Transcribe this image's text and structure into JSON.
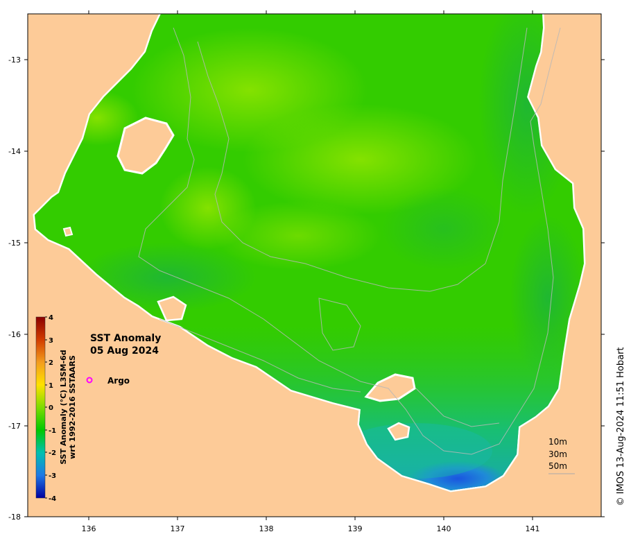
{
  "map": {
    "title_line1": "SST Anomaly",
    "title_line2": "05 Aug 2024",
    "x_ticks": [
      "136",
      "137",
      "138",
      "139",
      "140",
      "141"
    ],
    "y_ticks": [
      "-13",
      "-14",
      "-15",
      "-16",
      "-17",
      "-18"
    ],
    "legend_argo": "Argo",
    "argo_marker_color": "#ff00ff",
    "depth_labels": [
      "10m",
      "30m",
      "50m"
    ],
    "credit": "© IMOS 13-Aug-2024 11:51 Hobart",
    "land_color": "#fdcb98",
    "colors": {
      "ocean_main": "#33cc00",
      "ocean_light": "#66dd00",
      "ocean_yellowgreen": "#88e000",
      "ocean_cool": "#22bb44",
      "ocean_teal": "#11bba0",
      "ocean_blue": "#2266dd"
    }
  },
  "colorbar": {
    "title_line1": "SST Anomaly (°C) L3SM-6d",
    "title_line2": "wrt 1992-2016 SSTAARS",
    "ticks": [
      "4",
      "3",
      "2",
      "1",
      "0",
      "-1",
      "-2",
      "-3",
      "-4"
    ],
    "stops": [
      "#8b0000",
      "#d23c00",
      "#f39c1e",
      "#ffe100",
      "#7ddc00",
      "#00c800",
      "#00c0b0",
      "#1e78e6",
      "#0000a0"
    ]
  }
}
